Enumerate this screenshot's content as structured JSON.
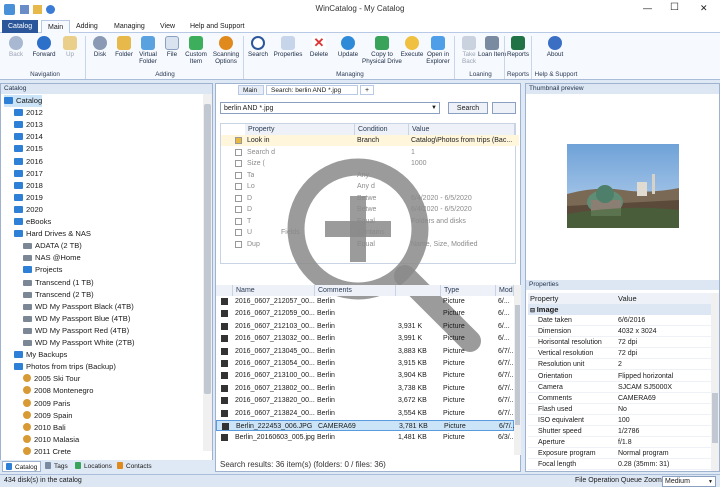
{
  "window": {
    "title": "WinCatalog - My Catalog",
    "min": "—",
    "max": "☐",
    "close": "✕"
  },
  "ribbon_tabs": [
    "Catalog",
    "Main",
    "Adding",
    "Managing",
    "View",
    "Help and Support"
  ],
  "ribbon": {
    "buttons": [
      {
        "label": "Back"
      },
      {
        "label": "Forward"
      },
      {
        "label": "Up"
      },
      {
        "label": "Disk"
      },
      {
        "label": "Folder"
      },
      {
        "label": "Virtual Folder"
      },
      {
        "label": "File"
      },
      {
        "label": "Custom Item"
      },
      {
        "label": "Scanning Options"
      },
      {
        "label": "Search"
      },
      {
        "label": "Properties"
      },
      {
        "label": "Delete"
      },
      {
        "label": "Update"
      },
      {
        "label": "Copy to Physical Drive"
      },
      {
        "label": "Execute"
      },
      {
        "label": "Open in Explorer"
      },
      {
        "label": "Take Back"
      },
      {
        "label": "Loan Item"
      },
      {
        "label": "Reports"
      },
      {
        "label": "About"
      }
    ],
    "groups": [
      "Navigation",
      "Adding",
      "Managing",
      "Loaning",
      "Reports",
      "Help & Support"
    ]
  },
  "catalog_panel": {
    "title": "Catalog",
    "tree": [
      {
        "label": "Catalog"
      },
      {
        "label": "2012"
      },
      {
        "label": "2013"
      },
      {
        "label": "2014"
      },
      {
        "label": "2015"
      },
      {
        "label": "2016"
      },
      {
        "label": "2017"
      },
      {
        "label": "2018"
      },
      {
        "label": "2019"
      },
      {
        "label": "2020"
      },
      {
        "label": "eBooks"
      },
      {
        "label": "Hard Drives & NAS"
      },
      {
        "label": "ADATA (2 TB)"
      },
      {
        "label": "NAS @Home"
      },
      {
        "label": "Projects"
      },
      {
        "label": "Transcend (1 TB)"
      },
      {
        "label": "Transcend (2 TB)"
      },
      {
        "label": "WD My Passport Black (4TB)"
      },
      {
        "label": "WD My Passport Blue (4TB)"
      },
      {
        "label": "WD My Passport Red (4TB)"
      },
      {
        "label": "WD My Passport White (2TB)"
      },
      {
        "label": "My Backups"
      },
      {
        "label": "Photos from trips (Backup)"
      },
      {
        "label": "2005 Ski Tour"
      },
      {
        "label": "2008 Montenegro"
      },
      {
        "label": "2009 Paris"
      },
      {
        "label": "2009 Spain"
      },
      {
        "label": "2010 Bali"
      },
      {
        "label": "2010 Malasia"
      },
      {
        "label": "2011 Crete"
      }
    ],
    "bottom_tabs": [
      "Catalog",
      "Tags",
      "Locations",
      "Contacts"
    ]
  },
  "search_panel": {
    "tabs": [
      "Main",
      "Search: berlin AND *.jpg",
      "+"
    ],
    "query": "berlin AND *.jpg",
    "search_button": "Search",
    "criteria_headers": [
      "Property",
      "Condition",
      "Value"
    ],
    "criteria": [
      {
        "property": "Look in",
        "condition": "Branch",
        "value": "Catalog\\Photos from trips (Bac..."
      },
      {
        "property": "Search d",
        "condition": "",
        "value": "1"
      },
      {
        "property": "Size (",
        "condition": "",
        "value": "1000"
      },
      {
        "property": "Ta",
        "condition": "Any",
        "value": ""
      },
      {
        "property": "Lo",
        "condition": "Any d",
        "value": ""
      },
      {
        "property": "D",
        "condition": "Betwe",
        "value": "6/4/2020 - 6/5/2020"
      },
      {
        "property": "D",
        "condition": "Betwe",
        "value": "6/4/2020 - 6/5/2020"
      },
      {
        "property": "T",
        "condition": "Equal",
        "value": "Folders and disks"
      },
      {
        "property": "U",
        "condition": "Contains",
        "value": ""
      },
      {
        "property": "Dup",
        "condition": "Equal",
        "value": "Name, Size, Modified"
      }
    ],
    "fields_label": "Fields",
    "results_headers": [
      "Name",
      "Comments",
      "",
      "Type",
      "Mod"
    ],
    "results": [
      {
        "name": "2016_0607_212057_00...",
        "comments": "Berlin",
        "size": "",
        "type": "Picture",
        "mod": "6/..."
      },
      {
        "name": "2016_0607_212059_00...",
        "comments": "Berlin",
        "size": "",
        "type": "Picture",
        "mod": "6/..."
      },
      {
        "name": "2016_0607_212103_00...",
        "comments": "Berlin",
        "size": "3,931 K",
        "type": "Picture",
        "mod": "6/..."
      },
      {
        "name": "2016_0607_213032_00...",
        "comments": "Berlin",
        "size": "3,991 K",
        "type": "Picture",
        "mod": "6/..."
      },
      {
        "name": "2016_0607_213045_00...",
        "comments": "Berlin",
        "size": "3,883 KB",
        "type": "Picture",
        "mod": "6/7/..."
      },
      {
        "name": "2016_0607_213054_00...",
        "comments": "Berlin",
        "size": "3,915 KB",
        "type": "Picture",
        "mod": "6/7/..."
      },
      {
        "name": "2016_0607_213100_00...",
        "comments": "Berlin",
        "size": "3,904 KB",
        "type": "Picture",
        "mod": "6/7/..."
      },
      {
        "name": "2016_0607_213802_00...",
        "comments": "Berlin",
        "size": "3,738 KB",
        "type": "Picture",
        "mod": "6/7/..."
      },
      {
        "name": "2016_0607_213820_00...",
        "comments": "Berlin",
        "size": "3,672 KB",
        "type": "Picture",
        "mod": "6/7/..."
      },
      {
        "name": "2016_0607_213824_00...",
        "comments": "Berlin",
        "size": "3,554 KB",
        "type": "Picture",
        "mod": "6/7/..."
      },
      {
        "name": "Berlin_222453_006.JPG",
        "comments": "CAMERA69",
        "size": "3,781 KB",
        "type": "Picture",
        "mod": "6/7/..."
      },
      {
        "name": "Berlin_20160603_005.jpg",
        "comments": "Berlin",
        "size": "1,481 KB",
        "type": "Picture",
        "mod": "6/3/..."
      }
    ],
    "selected_index": 10,
    "footer": "Search results: 36 item(s) (folders: 0 / files: 36)"
  },
  "thumbnail_panel": {
    "title": "Thumbnail preview"
  },
  "properties_panel": {
    "title": "Properties",
    "headers": [
      "Property",
      "Value"
    ],
    "section": "Image",
    "rows": [
      {
        "k": "Date taken",
        "v": "6/6/2016"
      },
      {
        "k": "Dimension",
        "v": "4032 x 3024"
      },
      {
        "k": "Horisontal resolution",
        "v": "72 dpi"
      },
      {
        "k": "Vertical resolution",
        "v": "72 dpi"
      },
      {
        "k": "Resolution unit",
        "v": "2"
      },
      {
        "k": "Orientation",
        "v": "Flipped horizontal"
      },
      {
        "k": "Camera",
        "v": "SJCAM SJ5000X"
      },
      {
        "k": "Comments",
        "v": "CAMERA69"
      },
      {
        "k": "Flash used",
        "v": "No"
      },
      {
        "k": "ISO equivalent",
        "v": "100"
      },
      {
        "k": "Shutter speed",
        "v": "1/2786"
      },
      {
        "k": "Aperture",
        "v": "f/1.8"
      },
      {
        "k": "Exposure program",
        "v": "Normal program"
      },
      {
        "k": "Focal length",
        "v": "0.28 (35mm: 31)"
      }
    ]
  },
  "status": {
    "left": "434 disk(s) in the catalog",
    "queue": "File Operation Queue",
    "zoom_label": "Zoom",
    "zoom_value": "Medium"
  },
  "colors": {
    "accent": "#2b579a",
    "selection": "#cce4f7",
    "folder": "#2d80d6"
  }
}
